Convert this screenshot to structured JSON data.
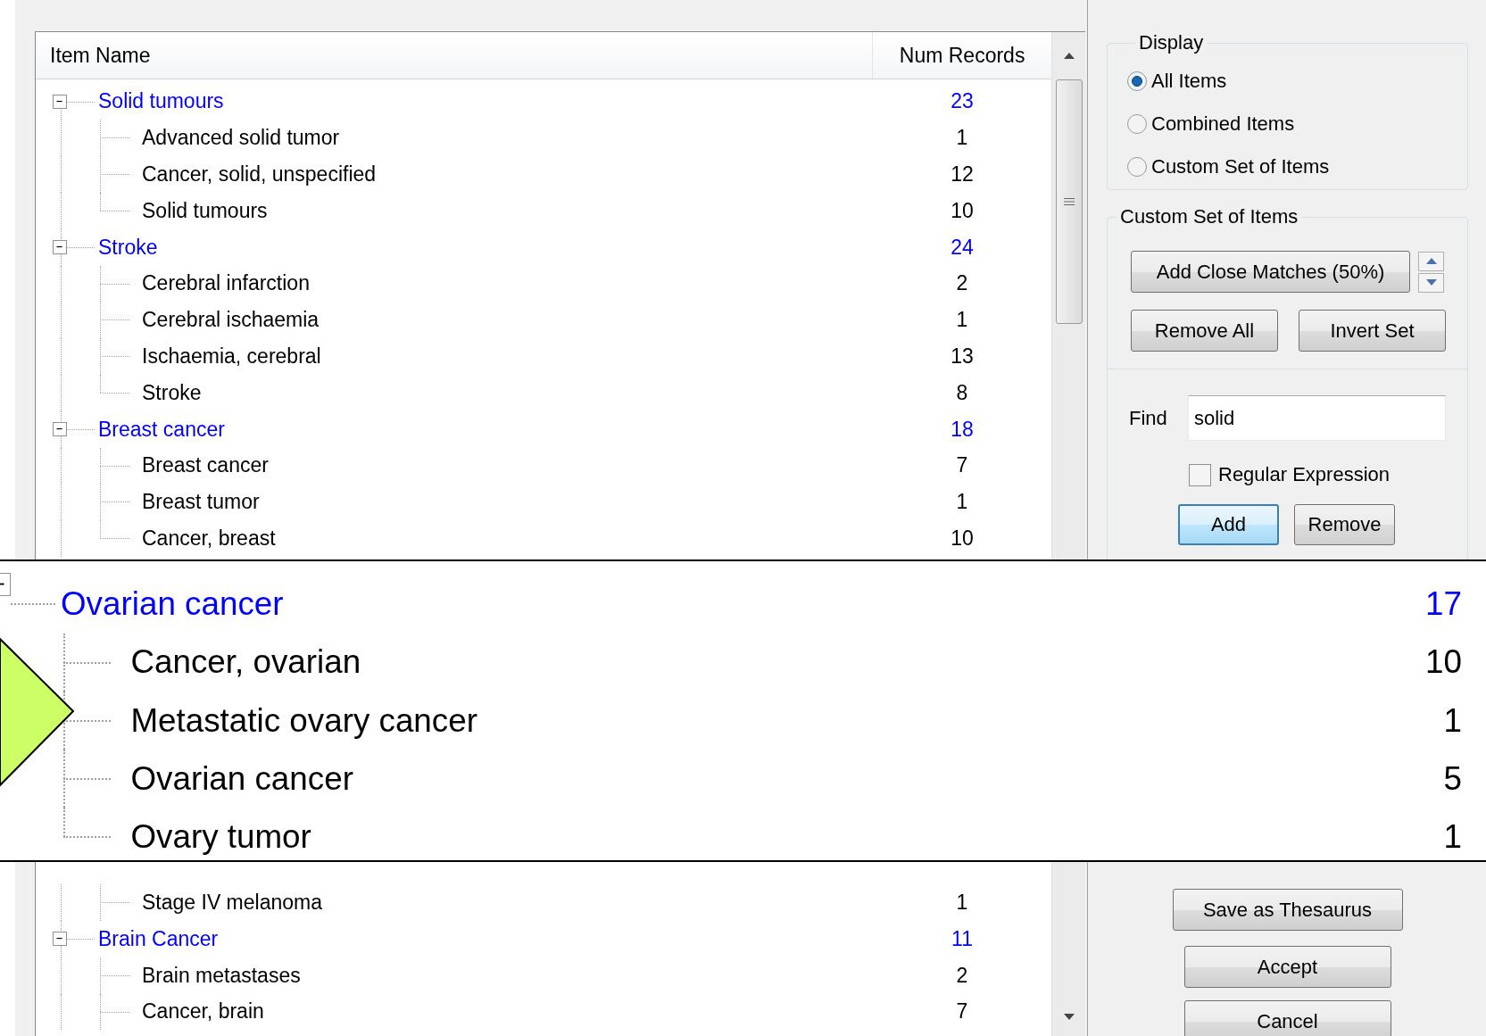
{
  "list": {
    "columns": [
      "Item Name",
      "Num Records"
    ],
    "groups_top": [
      {
        "name": "Solid tumours",
        "count": "23",
        "expanded": true,
        "children": [
          {
            "name": "Advanced solid tumor",
            "count": "1"
          },
          {
            "name": "Cancer, solid, unspecified",
            "count": "12"
          },
          {
            "name": "Solid tumours",
            "count": "10"
          }
        ]
      },
      {
        "name": "Stroke",
        "count": "24",
        "expanded": true,
        "children": [
          {
            "name": "Cerebral infarction",
            "count": "2"
          },
          {
            "name": "Cerebral ischaemia",
            "count": "1"
          },
          {
            "name": "Ischaemia, cerebral",
            "count": "13"
          },
          {
            "name": "Stroke",
            "count": "8"
          }
        ]
      },
      {
        "name": "Breast cancer",
        "count": "18",
        "expanded": true,
        "children": [
          {
            "name": "Breast cancer",
            "count": "7"
          },
          {
            "name": "Breast tumor",
            "count": "1"
          },
          {
            "name": "Cancer, breast",
            "count": "10"
          }
        ]
      }
    ],
    "groups_bottom": [
      {
        "children": [
          {
            "name": "Stage IV melanoma",
            "count": "1"
          }
        ]
      },
      {
        "name": "Brain Cancer",
        "count": "11",
        "expanded": true,
        "children": [
          {
            "name": "Brain metastases",
            "count": "2"
          },
          {
            "name": "Cancer, brain",
            "count": "7"
          }
        ]
      }
    ]
  },
  "magnifier": {
    "groups": [
      {
        "name": "Ovarian cancer",
        "count": "17",
        "children": [
          {
            "name": "Cancer, ovarian",
            "count": "10"
          },
          {
            "name": "Metastatic ovary cancer",
            "count": "1"
          },
          {
            "name": "Ovarian cancer",
            "count": "5"
          },
          {
            "name": "Ovary tumor",
            "count": "1"
          }
        ]
      }
    ]
  },
  "display": {
    "title": "Display",
    "options": [
      {
        "label": "All Items",
        "selected": true
      },
      {
        "label": "Combined Items",
        "selected": false
      },
      {
        "label": "Custom Set of Items",
        "selected": false
      }
    ]
  },
  "custom_set": {
    "title": "Custom Set of Items",
    "close_matches_button": "Add Close Matches (50%)",
    "set_buttons": [
      "Remove All",
      "Invert Set"
    ],
    "find_label": "Find",
    "find_value": "solid",
    "regex": {
      "label": "Regular Expression",
      "checked": false
    },
    "find_buttons": [
      {
        "label": "Add",
        "focused": true
      },
      {
        "label": "Remove",
        "focused": false
      }
    ]
  },
  "footer_buttons": [
    "Save as Thesaurus",
    "Accept",
    "Cancel"
  ]
}
